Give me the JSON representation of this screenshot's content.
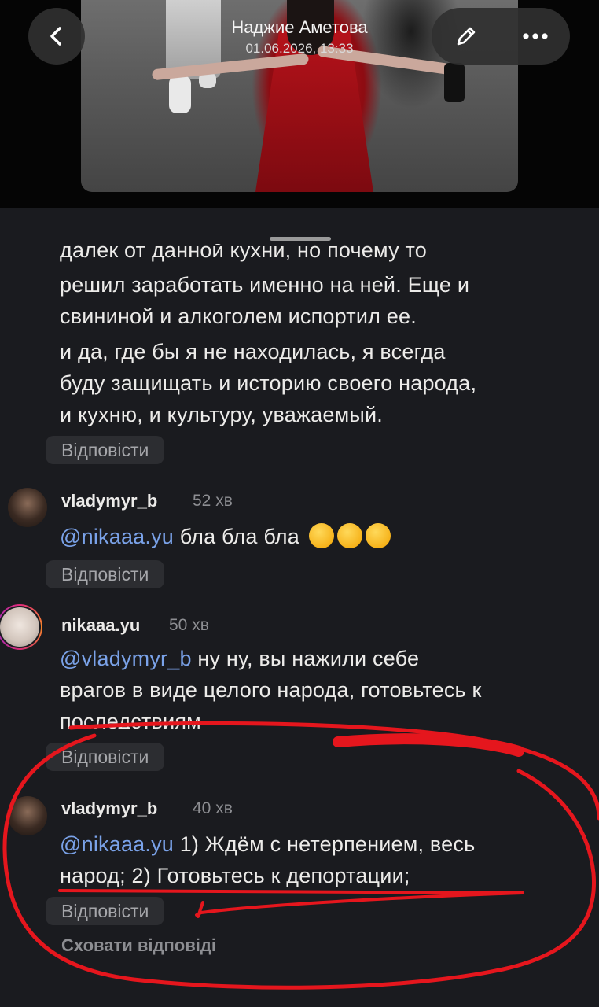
{
  "header": {
    "title": "Наджие Аметова",
    "subtitle": "01.06.2026, 13:33",
    "back_icon": "chevron-left-icon",
    "edit_icon": "pencil-icon",
    "more_icon": "more-horizontal-icon"
  },
  "comments": {
    "prev_tail": {
      "lines": [
        "далек от данной кухни, но почему то",
        "решил заработать именно на ней. Еще и",
        "свининой и алкоголем испортил ее.",
        "и да, где бы я не находилась, я всегда",
        "буду защищать и историю своего народа,",
        "и кухню, и культуру, уважаемый."
      ],
      "reply_label": "Відповісти"
    },
    "c1": {
      "username": "vladymyr_b",
      "time": "52 хв",
      "mention": "@nikaaa.yu",
      "text": "бла бла бла",
      "reply_label": "Відповісти"
    },
    "c2": {
      "username": "nikaaa.yu",
      "time": "50 хв",
      "mention": "@vladymyr_b",
      "line1": "ну ну, вы нажили себе",
      "line2": "врагов в виде целого народа, готовьтесь к",
      "line3": "последствиям",
      "reply_label": "Відповісти"
    },
    "c3": {
      "username": "vladymyr_b",
      "time": "40 хв",
      "mention": "@nikaaa.yu",
      "line1": "1) Ждём с нетерпением, весь",
      "line2": "народ; 2) Готовьтесь к депортации;",
      "reply_label": "Відповісти"
    },
    "hide_replies": "Сховати відповіді"
  },
  "annotation_color": "#e5161d"
}
